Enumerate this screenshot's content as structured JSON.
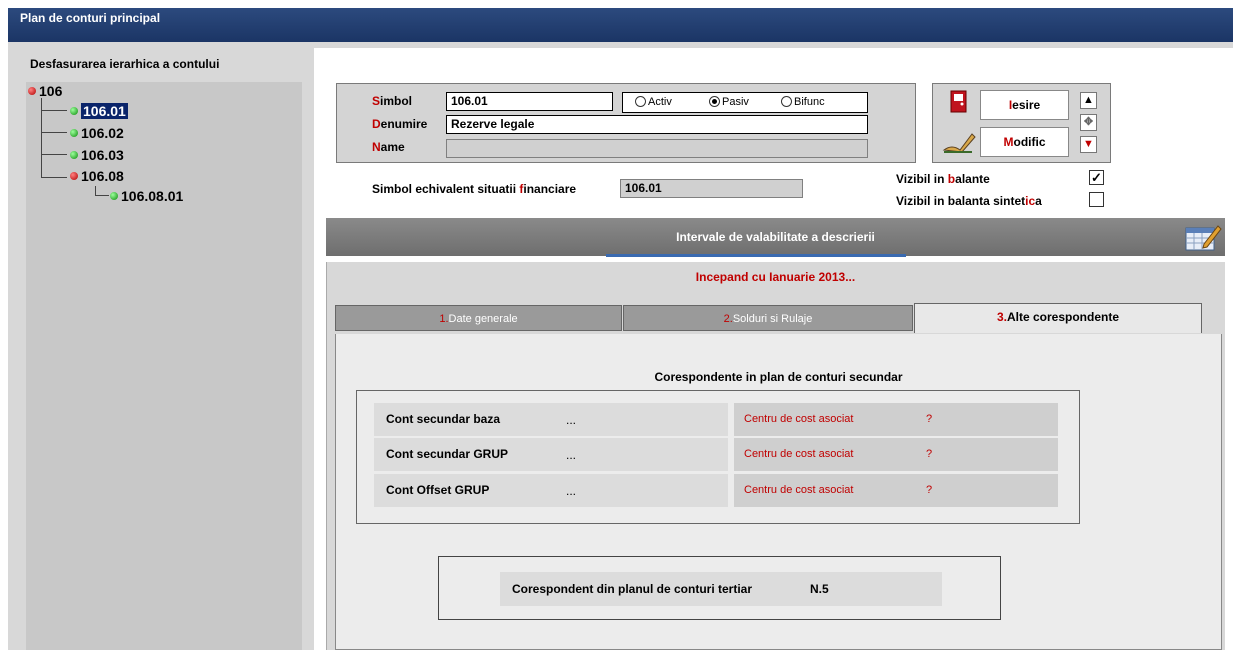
{
  "window": {
    "title": "Plan de conturi principal"
  },
  "tree": {
    "title": "Desfasurarea ierarhica a contului",
    "nodes": [
      {
        "label": "106",
        "status": "red"
      },
      {
        "label": "106.01",
        "status": "green",
        "selected": true
      },
      {
        "label": "106.02",
        "status": "green"
      },
      {
        "label": "106.03",
        "status": "green"
      },
      {
        "label": "106.08",
        "status": "red"
      },
      {
        "label": "106.08.01",
        "status": "green"
      }
    ]
  },
  "form": {
    "simbol_first": "S",
    "simbol_rest": "imbol",
    "simbol_value": "106.01",
    "denumire_first": "D",
    "denumire_rest": "enumire",
    "denumire_value": "Rezerve legale",
    "name_first": "N",
    "name_rest": "ame",
    "name_value": "",
    "radios": [
      {
        "label": "Activ",
        "checked": false
      },
      {
        "label": "Pasiv",
        "checked": true
      },
      {
        "label": "Bifunc",
        "checked": false
      }
    ],
    "echiv_label_a": "Simbol echivalent situatii ",
    "echiv_label_f": "f",
    "echiv_label_b": "inanciare",
    "echiv_value": "106.01"
  },
  "buttons": {
    "iesire_first": "I",
    "iesire_rest": "esire",
    "modific_first": "M",
    "modific_rest": "odific"
  },
  "checks": {
    "vizibil_balante_a": "Vizibil in ",
    "vizibil_balante_b": "b",
    "vizibil_balante_c": "alante",
    "vizibil_balante_checked": "✓",
    "vizibil_sint_a": "Vizibil in balanta sintet",
    "vizibil_sint_b": "ic",
    "vizibil_sint_c": "a",
    "vizibil_sint_checked": ""
  },
  "section": {
    "title": "Intervale de valabilitate a descrierii",
    "period": "Incepand cu Ianuarie 2013..."
  },
  "tabs": [
    {
      "num": "1.",
      "label": "Date generale"
    },
    {
      "num": "2.",
      "label": "Solduri si Rulaje"
    },
    {
      "num": "3.",
      "label": "Alte corespondente"
    }
  ],
  "corespondente": {
    "title": "Corespondente in plan de conturi secundar",
    "rows": [
      {
        "label": "Cont secundar baza",
        "value": "...",
        "cc_label": "Centru de cost asociat",
        "cc_value": "?"
      },
      {
        "label": "Cont secundar GRUP",
        "value": "...",
        "cc_label": "Centru de cost asociat",
        "cc_value": "?"
      },
      {
        "label": "Cont Offset GRUP",
        "value": "...",
        "cc_label": "Centru de cost asociat",
        "cc_value": "?"
      }
    ]
  },
  "tertiar": {
    "label": "Corespondent din planul de conturi tertiar",
    "value": "N.5"
  },
  "colors": {
    "title_bar": "#1b3565",
    "accent_red": "#c00000",
    "selection": "#0a246a"
  }
}
